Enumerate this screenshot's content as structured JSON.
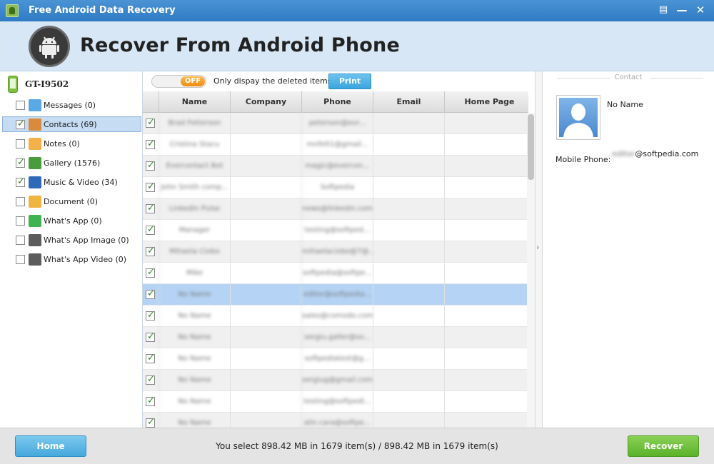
{
  "window": {
    "title": "Free Android Data Recovery",
    "icons": [
      "notes-icon",
      "minimize-icon",
      "close-icon"
    ]
  },
  "header": {
    "title": "Recover From Android Phone",
    "icon": "android-icon"
  },
  "sidebar": {
    "device": "GT-I9502",
    "categories": [
      {
        "label": "Messages (0)",
        "checked": false,
        "icon": "messages-icon",
        "color": "#5aa9e6"
      },
      {
        "label": "Contacts (69)",
        "checked": true,
        "icon": "contacts-icon",
        "color": "#d98a3a",
        "selected": true
      },
      {
        "label": "Notes (0)",
        "checked": false,
        "icon": "notes-icon",
        "color": "#f3b04b"
      },
      {
        "label": "Gallery (1576)",
        "checked": true,
        "icon": "gallery-icon",
        "color": "#4a9a3e"
      },
      {
        "label": "Music & Video (34)",
        "checked": true,
        "icon": "music-video-icon",
        "color": "#2f6ab8"
      },
      {
        "label": "Document (0)",
        "checked": false,
        "icon": "document-icon",
        "color": "#f0b440"
      },
      {
        "label": "What's App (0)",
        "checked": false,
        "icon": "whatsapp-icon",
        "color": "#3fb34f"
      },
      {
        "label": "What's App Image (0)",
        "checked": false,
        "icon": "whatsapp-image-icon",
        "color": "#5c5c5c"
      },
      {
        "label": "What's App Video (0)",
        "checked": false,
        "icon": "whatsapp-video-icon",
        "color": "#5c5c5c"
      }
    ]
  },
  "toolbar": {
    "toggle_label": "OFF",
    "filter_label": "Only dispay the deleted items",
    "print_label": "Print"
  },
  "table": {
    "columns": [
      "Name",
      "Company",
      "Phone",
      "Email",
      "Home Page"
    ],
    "rows": [
      {
        "name": "Brad Fetterson",
        "phone": "peterson@evr..."
      },
      {
        "name": "Cristina Stacu",
        "phone": "mnfelt1@gmail..."
      },
      {
        "name": "Evercontact Bot",
        "phone": "magic@evercon..."
      },
      {
        "name": "John Smith comp...",
        "phone": "Softpedia"
      },
      {
        "name": "LinkedIn Pulse",
        "phone": "news@linkedin.com"
      },
      {
        "name": "Manager",
        "phone": "testing@softped..."
      },
      {
        "name": "Mihaela Ciobo",
        "phone": "mihaelaciobo@7@..."
      },
      {
        "name": "Mike",
        "phone": "softpedia@softpe..."
      },
      {
        "name": "No Name",
        "phone": "editor@softpedia...",
        "selected": true
      },
      {
        "name": "No Name",
        "phone": "sales@comodo.com"
      },
      {
        "name": "No Name",
        "phone": "sergiu.galler@so..."
      },
      {
        "name": "No Name",
        "phone": "softpediatest@g..."
      },
      {
        "name": "No Name",
        "phone": "sergiug@gmail.com"
      },
      {
        "name": "No Name",
        "phone": "testing@softpedi..."
      },
      {
        "name": "No Name",
        "phone": "alin.cara@softpe..."
      }
    ]
  },
  "contact": {
    "section_title": "Contact",
    "name": "No Name",
    "mobile_label": "Mobile Phone:",
    "mobile_prefix": "editor",
    "mobile_suffix": "@softpedia.com"
  },
  "footer": {
    "home_label": "Home",
    "status": "You select 898.42 MB in 1679 item(s) / 898.42 MB in 1679 item(s)",
    "recover_label": "Recover"
  }
}
